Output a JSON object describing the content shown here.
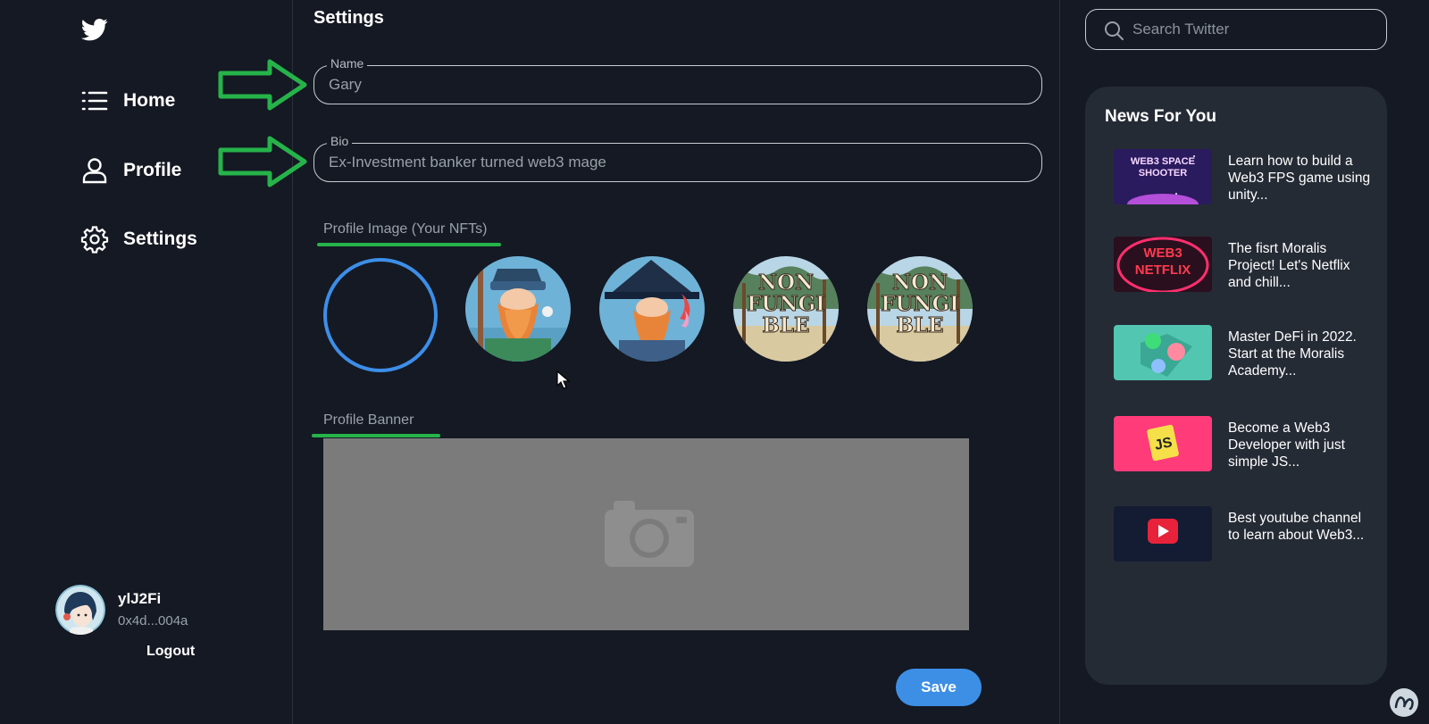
{
  "sidebar": {
    "items": [
      {
        "label": "Home",
        "icon": "list-icon"
      },
      {
        "label": "Profile",
        "icon": "user-icon"
      },
      {
        "label": "Settings",
        "icon": "gear-icon"
      }
    ],
    "user": {
      "name": "ylJ2Fi",
      "address": "0x4d...004a",
      "logout_label": "Logout"
    }
  },
  "main": {
    "title": "Settings",
    "name_field": {
      "label": "Name",
      "value": "Gary"
    },
    "bio_field": {
      "label": "Bio",
      "value": "Ex-Investment banker turned web3 mage"
    },
    "profile_image_label": "Profile Image (Your NFTs)",
    "nft_badge_text": "NON FUNGI BLE",
    "banner_label": "Profile Banner",
    "save_label": "Save"
  },
  "right": {
    "search_placeholder": "Search Twitter",
    "news_title": "News For You",
    "news": [
      {
        "text": "Learn how to build a Web3 FPS game using unity...",
        "thumb_text": "WEB3 SPACE SHOOTER"
      },
      {
        "text": "The fisrt Moralis Project! Let's Netflix and chill...",
        "thumb_text": "WEB3 NETFLIX"
      },
      {
        "text": "Master DeFi in 2022. Start at the Moralis Academy...",
        "thumb_text": ""
      },
      {
        "text": "Become a Web3 Developer with just simple JS...",
        "thumb_text": "JS"
      },
      {
        "text": "Best youtube channel to learn about Web3...",
        "thumb_text": ""
      }
    ]
  },
  "colors": {
    "background": "#141923",
    "panel": "#252b35",
    "accent": "#3d8fe6",
    "annotation_green": "#26b34a"
  }
}
